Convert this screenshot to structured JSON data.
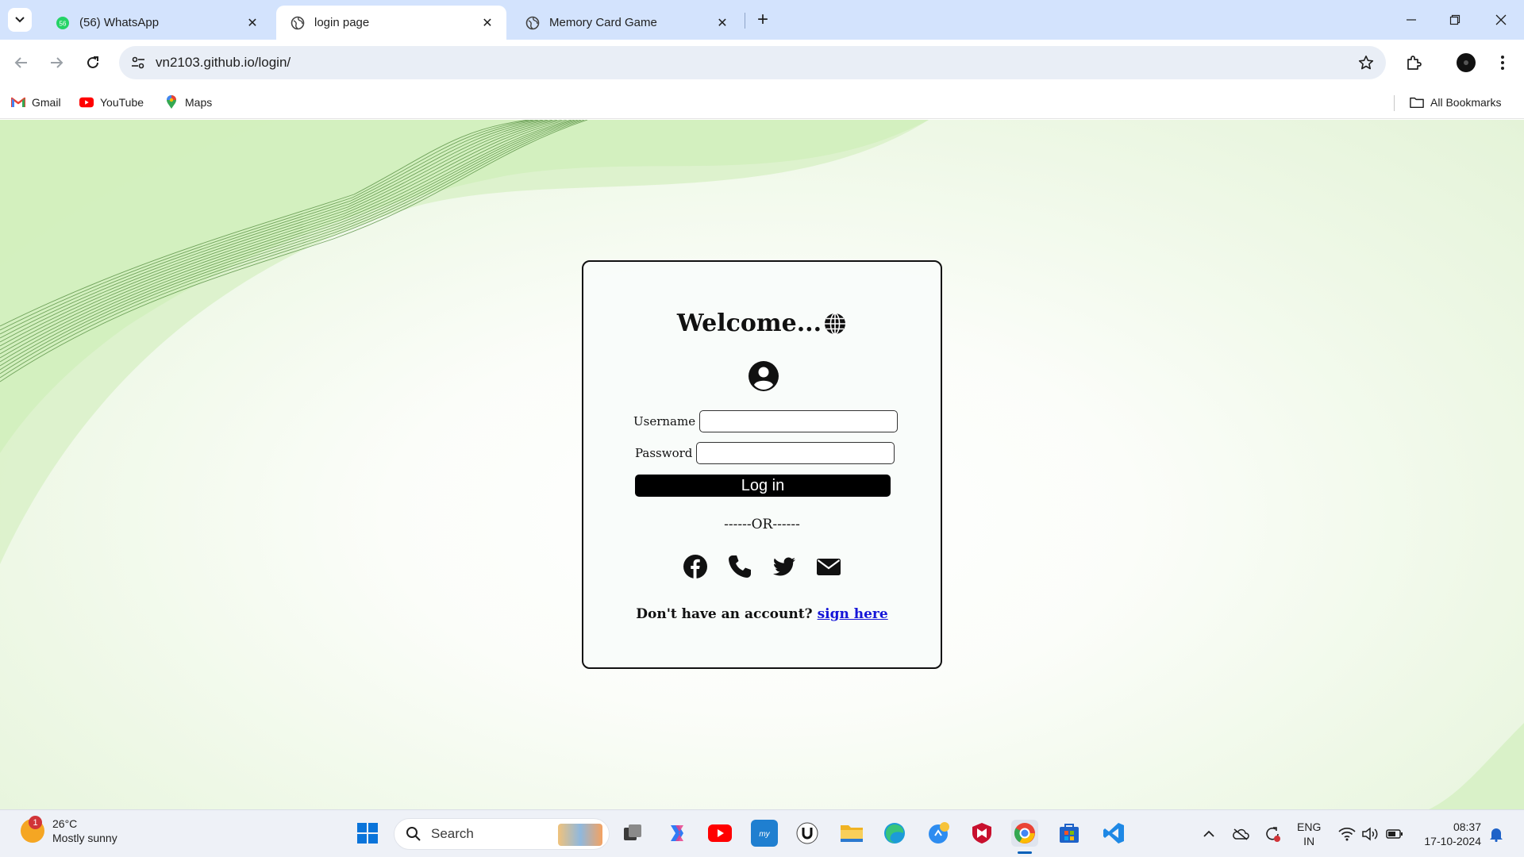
{
  "browser": {
    "tabs": [
      {
        "title": "(56) WhatsApp",
        "badge": "56",
        "active": false
      },
      {
        "title": "login page",
        "active": true
      },
      {
        "title": "Memory Card Game",
        "active": false
      }
    ],
    "url": "vn2103.github.io/login/",
    "bookmarks": [
      {
        "label": "Gmail",
        "icon": "gmail-icon"
      },
      {
        "label": "YouTube",
        "icon": "youtube-icon"
      },
      {
        "label": "Maps",
        "icon": "maps-icon"
      }
    ],
    "all_bookmarks_label": "All Bookmarks"
  },
  "login": {
    "welcome": "Welcome...",
    "username_label": "Username",
    "password_label": "Password",
    "username_value": "",
    "password_value": "",
    "login_button": "Log in",
    "divider": "------OR------",
    "signup_prompt": "Don't have an account?",
    "signup_link": "sign here",
    "social_icons": [
      "facebook-icon",
      "phone-icon",
      "twitter-icon",
      "envelope-icon"
    ]
  },
  "taskbar": {
    "weather_temp": "26°C",
    "weather_desc": "Mostly sunny",
    "weather_badge": "1",
    "search_label": "Search",
    "lang_line1": "ENG",
    "lang_line2": "IN",
    "time": "08:37",
    "date": "17-10-2024"
  },
  "colors": {
    "tab_strip": "#d3e3fd",
    "omnibox": "#e9eef6",
    "page_green": "#e4f3d8",
    "button": "#000000",
    "link": "#1515d8"
  }
}
